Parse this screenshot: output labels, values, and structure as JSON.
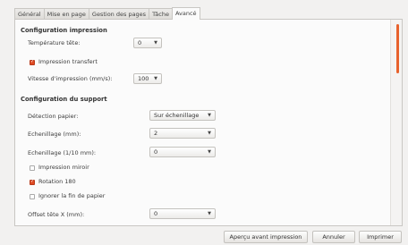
{
  "tabs": [
    "Général",
    "Mise en page",
    "Gestion des pages",
    "Tâche",
    "Avancé"
  ],
  "impression": {
    "title": "Configuration impression",
    "temp_label": "Température tête:",
    "temp_value": "0",
    "transfer_label": "Impression transfert",
    "transfer_checked": true,
    "speed_label": "Vitesse d'impression (mm/s):",
    "speed_value": "100"
  },
  "support": {
    "title": "Configuration du support",
    "detect_label": "Détection papier:",
    "detect_value": "Sur échenillage",
    "ech_label": "Echenillage (mm):",
    "ech_value": "2",
    "ech10_label": "Echenillage (1/10 mm):",
    "ech10_value": "0",
    "mirror_label": "Impression miroir",
    "mirror_checked": false,
    "rot_label": "Rotation 180",
    "rot_checked": true,
    "ignore_label": "Ignorer la fin de papier",
    "ignore_checked": false,
    "offset_label": "Offset tête X (mm):",
    "offset_value": "0"
  },
  "buttons": {
    "preview": "Aperçu avant impression",
    "cancel": "Annuler",
    "print": "Imprimer"
  },
  "colors": {
    "accent": "#df4a22",
    "scrollbar": "#e8622c"
  }
}
